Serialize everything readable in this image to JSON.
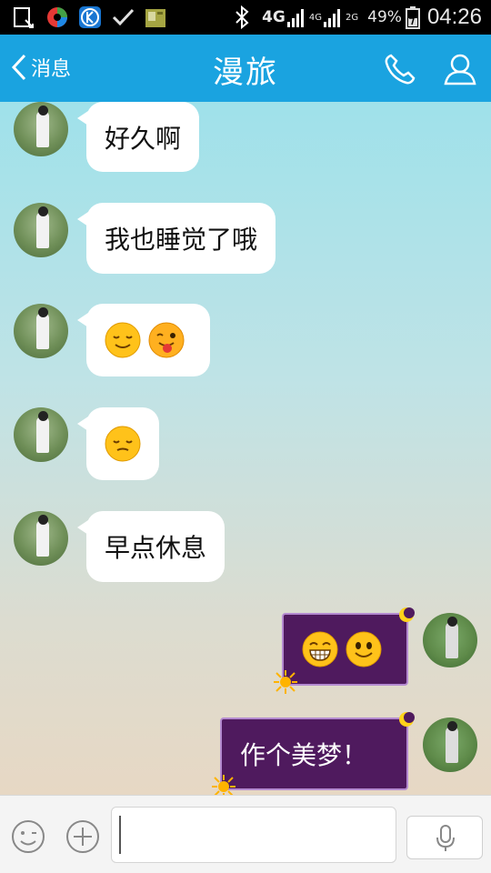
{
  "status_bar": {
    "network_label": "4G",
    "signal_4g_label": "4G",
    "signal_2g_label": "2G",
    "battery": "49%",
    "time": "04:26"
  },
  "nav": {
    "back_label": "消息",
    "title": "漫旅"
  },
  "messages": [
    {
      "side": "left",
      "type": "text",
      "text": "好久啊"
    },
    {
      "side": "left",
      "type": "text",
      "text": "我也睡觉了哦"
    },
    {
      "side": "left",
      "type": "emoji",
      "emojis": [
        "smile-emoji",
        "tongue-wink-emoji"
      ]
    },
    {
      "side": "left",
      "type": "emoji",
      "emojis": [
        "sleepy-emoji"
      ]
    },
    {
      "side": "left",
      "type": "text",
      "text": "早点休息"
    },
    {
      "side": "right",
      "type": "emoji",
      "emojis": [
        "grin-emoji",
        "happy-emoji"
      ]
    },
    {
      "side": "right",
      "type": "text",
      "text": "作个美梦！"
    }
  ],
  "input": {
    "value": "",
    "placeholder": ""
  },
  "colors": {
    "nav_bg": "#1aa3e0",
    "bubble_theme": "#4f1a5e"
  }
}
